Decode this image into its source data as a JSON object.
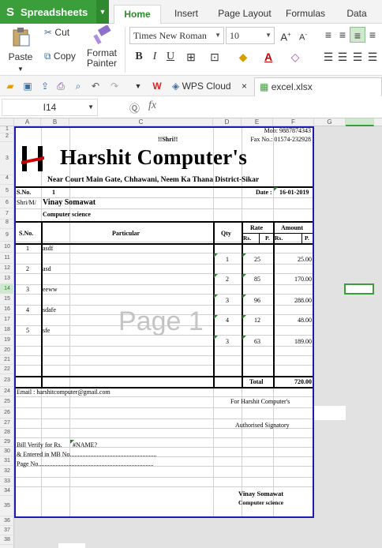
{
  "app": {
    "name": "Spreadsheets",
    "accent": "#3a9f3a"
  },
  "tabs": [
    "Home",
    "Insert",
    "Page Layout",
    "Formulas",
    "Data"
  ],
  "ribbon": {
    "paste": "Paste",
    "cut": "Cut",
    "copy": "Copy",
    "format_painter_1": "Format",
    "format_painter_2": "Painter",
    "font_name": "Times New Roman",
    "font_size": "10"
  },
  "quickbar": {
    "wps_cloud": "WPS Cloud",
    "file_tab": "excel.xlsx"
  },
  "formula_bar": {
    "cell_ref": "I14",
    "fx": "fx"
  },
  "columns": [
    "A",
    "B",
    "C",
    "D",
    "E",
    "F",
    "G"
  ],
  "rows": [
    "1",
    "2",
    "3",
    "4",
    "5",
    "6",
    "7",
    "8",
    "9",
    "10",
    "11",
    "12",
    "13",
    "14",
    "15",
    "16",
    "17",
    "18",
    "19",
    "20",
    "21",
    "22",
    "23",
    "24",
    "25",
    "26",
    "27",
    "28",
    "29",
    "30",
    "31",
    "32",
    "33",
    "34",
    "35",
    "36",
    "37",
    "38"
  ],
  "invoice": {
    "mob": "Mob: 9887874343",
    "shri": "!!Shri!!",
    "fax": "Fax No.: 01574-232928",
    "company": "Harshit Computer's",
    "address": "Near Court Main Gate, Chhawani, Neem Ka Thana District-Sikar",
    "sno_label": "S.No.",
    "sno_value": "1",
    "date_label": "Date :",
    "date_value": "16-01-2019",
    "shri_m_label": "Shri/M/",
    "customer_name": "Vinay Somawat",
    "customer_sub": "Computer science",
    "headers": {
      "sno": "S.No.",
      "particular": "Particular",
      "qty": "Qty",
      "rate": "Rate",
      "amount": "Amount",
      "rs": "Rs.",
      "p": "P."
    },
    "items": [
      {
        "sno": "1",
        "particular": "asdf",
        "qty": "1",
        "rate": "25",
        "amount": "25.00"
      },
      {
        "sno": "2",
        "particular": "asd",
        "qty": "2",
        "rate": "85",
        "amount": "170.00"
      },
      {
        "sno": "3",
        "particular": "eeww",
        "qty": "3",
        "rate": "96",
        "amount": "288.00"
      },
      {
        "sno": "4",
        "particular": "sdafe",
        "qty": "4",
        "rate": "12",
        "amount": "48.00"
      },
      {
        "sno": "5",
        "particular": "sfe",
        "qty": "3",
        "rate": "63",
        "amount": "189.00"
      }
    ],
    "total_label": "Total",
    "total_value": "720.00",
    "email": "Email : harshitcomputer@gmail.com",
    "for_company": "For Harshit Computer's",
    "signatory": "Authorised Signatory",
    "bill_verify": "Bill Verify for Rs.",
    "name_err": "#NAME?",
    "entered_mb": "& Entered in MB No.......................................................",
    "page_no": "Page No.........................................................................",
    "sign_name": "Vinay Somawat",
    "sign_sub": "Computer science",
    "watermark": "Page 1"
  }
}
